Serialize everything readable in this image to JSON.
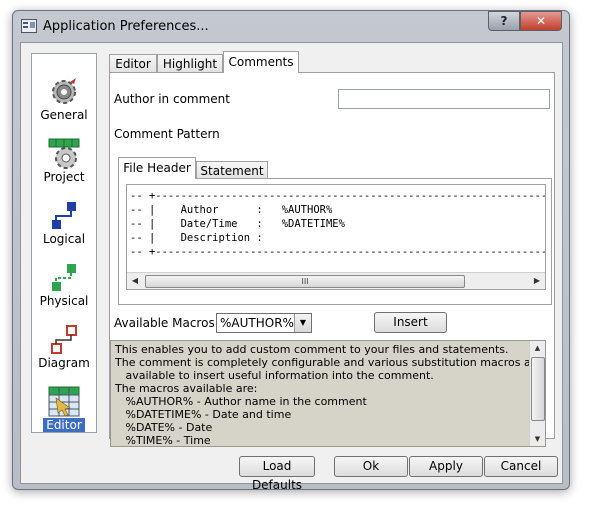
{
  "window": {
    "title": "Application Preferences...",
    "help_symbol": "?",
    "close_symbol": "✕"
  },
  "nav": {
    "items": [
      {
        "label": "General",
        "icon": "gear-icon"
      },
      {
        "label": "Project",
        "icon": "project-gear-icon"
      },
      {
        "label": "Logical",
        "icon": "logical-diagram-icon"
      },
      {
        "label": "Physical",
        "icon": "physical-diagram-icon"
      },
      {
        "label": "Diagram",
        "icon": "diagram-icon"
      },
      {
        "label": "Editor",
        "icon": "editor-grid-icon",
        "selected": true
      }
    ]
  },
  "tabs": [
    {
      "label": "Editor"
    },
    {
      "label": "Highlight"
    },
    {
      "label": "Comments",
      "active": true
    }
  ],
  "comments": {
    "author_label": "Author in comment",
    "author_value": "",
    "pattern_label": "Comment Pattern",
    "subtabs": [
      {
        "label": "File Header",
        "active": true
      },
      {
        "label": "Statement"
      }
    ],
    "code_lines": [
      "-- +--------------------------------------------------------------",
      "-- |    Author      :   %AUTHOR%",
      "-- |    Date/Time   :   %DATETIME%",
      "-- |    Description :",
      "-- +--------------------------------------------------------------"
    ],
    "hscroll_grip": "III",
    "macros_label": "Available Macros",
    "macro_selected": "%AUTHOR%",
    "insert_label": "Insert",
    "description_lines": [
      "This enables you to add custom comment to your files and statements.",
      "The comment is completely configurable and various substitution macros are",
      "   available to insert useful information into the comment.",
      "The macros available are:",
      "   %AUTHOR% - Author name in the comment",
      "   %DATETIME% - Date and time",
      "   %DATE% - Date",
      "   %TIME% - Time"
    ]
  },
  "buttons": {
    "load_defaults": "Load Defaults",
    "ok": "Ok",
    "apply": "Apply",
    "cancel": "Cancel"
  },
  "colors": {
    "selection": "#3c6fc1",
    "description_bg": "#d6d3c8",
    "close_red": "#c2402c"
  }
}
